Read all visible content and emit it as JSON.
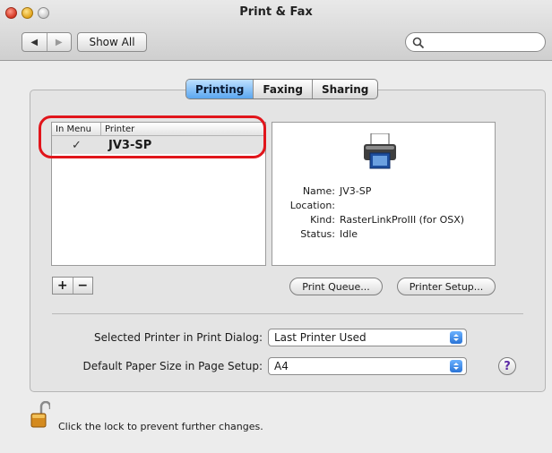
{
  "window": {
    "title": "Print & Fax"
  },
  "toolbar": {
    "back": "◀",
    "forward": "▶",
    "show_all": "Show All"
  },
  "search": {
    "placeholder": "",
    "icon": "search-icon"
  },
  "tabs": [
    {
      "label": "Printing",
      "selected": true
    },
    {
      "label": "Faxing",
      "selected": false
    },
    {
      "label": "Sharing",
      "selected": false
    }
  ],
  "printer_list": {
    "headers": {
      "in_menu": "In Menu",
      "printer": "Printer"
    },
    "rows": [
      {
        "check": "✓",
        "name": "JV3-SP"
      }
    ]
  },
  "details": {
    "icon": "printer-icon",
    "fields": [
      {
        "key": "Name:",
        "value": "JV3-SP"
      },
      {
        "key": "Location:",
        "value": ""
      },
      {
        "key": "Kind:",
        "value": "RasterLinkProIII (for OSX)"
      },
      {
        "key": "Status:",
        "value": "Idle"
      }
    ]
  },
  "list_controls": {
    "add": "+",
    "remove": "−"
  },
  "buttons": {
    "print_queue": "Print Queue...",
    "printer_setup": "Printer Setup..."
  },
  "settings": {
    "selected_printer_label": "Selected Printer in Print Dialog:",
    "selected_printer_value": "Last Printer Used",
    "paper_size_label": "Default Paper Size in Page Setup:",
    "paper_size_value": "A4"
  },
  "help": {
    "label": "?"
  },
  "lock": {
    "text": "Click the lock to prevent further changes."
  },
  "colors": {
    "highlight": "#e1151b",
    "tab_active": "#5aa6f0"
  }
}
